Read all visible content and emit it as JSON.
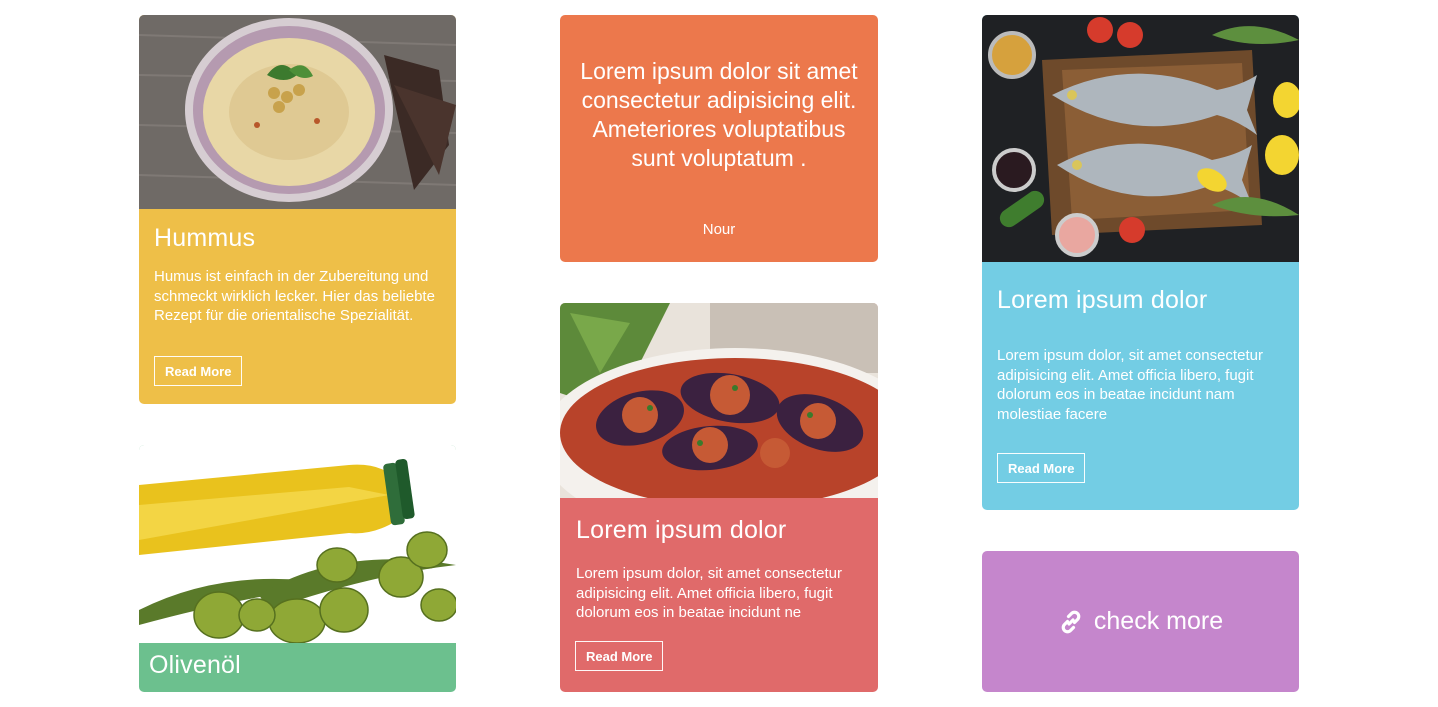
{
  "cards": {
    "hummus": {
      "title": "Hummus",
      "description": "Humus ist einfach in der Zubereitung und schmeckt wirklich lecker. Hier das beliebte Rezept für die orientalische Spezialität.",
      "button": "Read More",
      "color": "#EEBF48"
    },
    "quote": {
      "text": "Lorem ipsum dolor sit amet consectetur adipisicing elit. Ameteriores voluptatibus sunt voluptatum .",
      "author": "Nour",
      "color": "#EC784C"
    },
    "fish": {
      "title": "Lorem ipsum dolor",
      "description": "Lorem ipsum dolor, sit amet consectetur adipisicing elit. Amet officia libero, fugit dolorum eos in beatae incidunt nam molestiae facere",
      "button": "Read More",
      "color": "#73CDE4"
    },
    "eggplant": {
      "title": "Lorem ipsum dolor",
      "description": "Lorem ipsum dolor, sit amet consectetur adipisicing elit. Amet officia libero, fugit dolorum eos in beatae incidunt ne",
      "button": "Read More",
      "color": "#E06A6A"
    },
    "olive": {
      "title": "Olivenöl",
      "color": "#6CC08E"
    },
    "check": {
      "label": "check more",
      "icon": "link-icon",
      "color": "#C586CC"
    }
  }
}
